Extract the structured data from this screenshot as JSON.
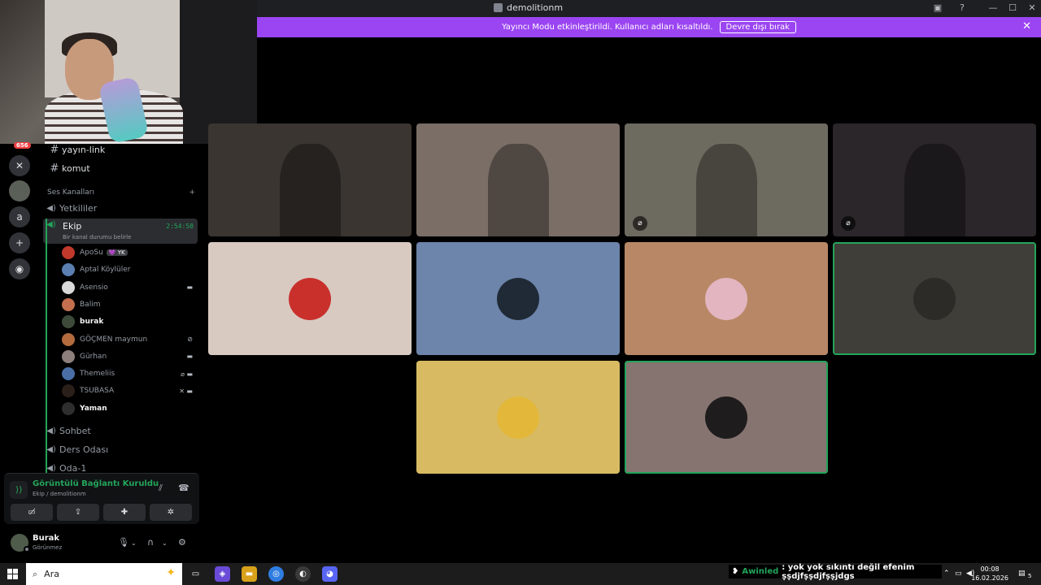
{
  "window": {
    "title": "demolitionm",
    "controls": [
      "—",
      "☐",
      "✕"
    ]
  },
  "banner": {
    "message": "Yayıncı Modu etkinleştirildi. Kullanıcı adları kısaltıldı.",
    "button": "Devre dışı bırak",
    "close": "✕"
  },
  "rail": {
    "badge": "656",
    "dm_letter": "a"
  },
  "sidebar": {
    "text_channels": [
      {
        "name": "yayın-link"
      },
      {
        "name": "komut"
      }
    ],
    "voice_section": "Ses Kanalları",
    "voice_above": "Yetkililer",
    "active": {
      "name": "Ekip",
      "timer": "2:54:58",
      "status": "Bir kanal durumu belirle"
    },
    "members": [
      {
        "name": "ApoSu",
        "tag": "💜 YK",
        "color": "#c0392b",
        "bold": false,
        "icons": ""
      },
      {
        "name": "Aptal Köylüler",
        "tag": "",
        "color": "#5a7fb0",
        "bold": false,
        "icons": ""
      },
      {
        "name": "Asensio",
        "tag": "",
        "color": "#d9d9d9",
        "bold": false,
        "icons": "▬"
      },
      {
        "name": "Balim",
        "tag": "",
        "color": "#c26e4f",
        "bold": false,
        "icons": ""
      },
      {
        "name": "burak",
        "tag": "",
        "color": "#3d4a3a",
        "bold": true,
        "icons": ""
      },
      {
        "name": "GÖÇMEN maymun",
        "tag": "",
        "color": "#b36b3d",
        "bold": false,
        "icons": "⊘"
      },
      {
        "name": "Gürhan",
        "tag": "",
        "color": "#8d7f7c",
        "bold": false,
        "icons": "▬"
      },
      {
        "name": "Themeliis",
        "tag": "",
        "color": "#4a6fa5",
        "bold": false,
        "icons": "⌀ ▬"
      },
      {
        "name": "TSUBASA",
        "tag": "",
        "color": "#2b1f1a",
        "bold": false,
        "icons": "✕ ▬"
      },
      {
        "name": "Yaman",
        "tag": "",
        "color": "#2e2e2e",
        "bold": true,
        "icons": ""
      }
    ],
    "voice_below": [
      "Sohbet",
      "Ders Odası",
      "Oda-1"
    ]
  },
  "voice_panel": {
    "title": "Görüntülü Bağlantı Kuruldu",
    "subtitle": "Ekip / demolitionm",
    "buttons": [
      "▭̸",
      "⇪",
      "✚",
      "✲"
    ]
  },
  "user_panel": {
    "name": "Burak",
    "status": "Görünmez"
  },
  "tiles": [
    {
      "type": "video",
      "color": "#3a3530",
      "name": "cam-1"
    },
    {
      "type": "video",
      "color": "#7a6e66",
      "name": "cam-2"
    },
    {
      "type": "video",
      "color": "#6d6a5f",
      "name": "cam-3",
      "muted": true
    },
    {
      "type": "video",
      "color": "#2a262a",
      "name": "cam-4",
      "muted": true
    },
    {
      "type": "avatar",
      "color": "#d8cac1",
      "avatar_color": "#c9302c"
    },
    {
      "type": "avatar",
      "color": "#6d85ab",
      "avatar_color": "#1f2a36"
    },
    {
      "type": "avatar",
      "color": "#b88866",
      "avatar_color": "#e2b5c1"
    },
    {
      "type": "avatar",
      "color": "#403e38",
      "avatar_color": "#2d2b28",
      "speaking": true
    },
    {
      "type": "avatar",
      "color": "#d8ba62",
      "avatar_color": "#e3b83a"
    },
    {
      "type": "avatar",
      "color": "#867470",
      "avatar_color": "#1e1c1c",
      "speaking": true
    }
  ],
  "taskbar": {
    "search_label": "Ara",
    "chat": {
      "name": "Awinled",
      "text": ": yok yok sıkıntı değil efenim ṣṣdjfṣṣdjfṣṣjdgs"
    },
    "time": "00:08",
    "date": "16.02.2026",
    "notifications": "5"
  }
}
